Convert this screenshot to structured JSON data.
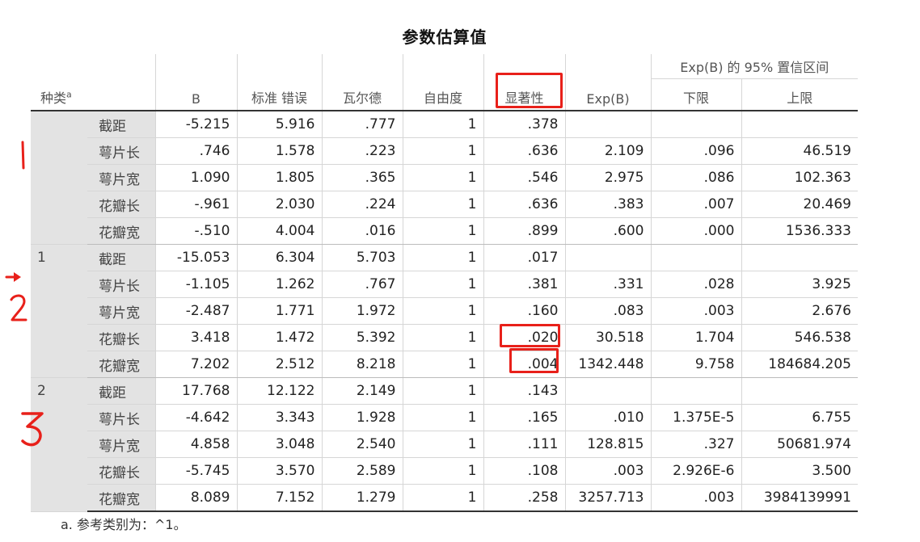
{
  "title": "参数估算值",
  "headers": {
    "group": "种类",
    "group_sup": "a",
    "b": "B",
    "se": "标准 错误",
    "wald": "瓦尔德",
    "df": "自由度",
    "sig": "显著性",
    "expb": "Exp(B)",
    "ci_title": "Exp(B) 的 95% 置信区间",
    "ci_lower": "下限",
    "ci_upper": "上限"
  },
  "groups": [
    {
      "label": "",
      "rows": [
        {
          "param": "截距",
          "b": "-5.215",
          "se": "5.916",
          "wald": ".777",
          "df": "1",
          "sig": ".378",
          "expb": "",
          "lower": "",
          "upper": ""
        },
        {
          "param": "萼片长",
          "b": ".746",
          "se": "1.578",
          "wald": ".223",
          "df": "1",
          "sig": ".636",
          "expb": "2.109",
          "lower": ".096",
          "upper": "46.519"
        },
        {
          "param": "萼片宽",
          "b": "1.090",
          "se": "1.805",
          "wald": ".365",
          "df": "1",
          "sig": ".546",
          "expb": "2.975",
          "lower": ".086",
          "upper": "102.363"
        },
        {
          "param": "花瓣长",
          "b": "-.961",
          "se": "2.030",
          "wald": ".224",
          "df": "1",
          "sig": ".636",
          "expb": ".383",
          "lower": ".007",
          "upper": "20.469"
        },
        {
          "param": "花瓣宽",
          "b": "-.510",
          "se": "4.004",
          "wald": ".016",
          "df": "1",
          "sig": ".899",
          "expb": ".600",
          "lower": ".000",
          "upper": "1536.333"
        }
      ]
    },
    {
      "label": "1",
      "rows": [
        {
          "param": "截距",
          "b": "-15.053",
          "se": "6.304",
          "wald": "5.703",
          "df": "1",
          "sig": ".017",
          "expb": "",
          "lower": "",
          "upper": ""
        },
        {
          "param": "萼片长",
          "b": "-1.105",
          "se": "1.262",
          "wald": ".767",
          "df": "1",
          "sig": ".381",
          "expb": ".331",
          "lower": ".028",
          "upper": "3.925"
        },
        {
          "param": "萼片宽",
          "b": "-2.487",
          "se": "1.771",
          "wald": "1.972",
          "df": "1",
          "sig": ".160",
          "expb": ".083",
          "lower": ".003",
          "upper": "2.676"
        },
        {
          "param": "花瓣长",
          "b": "3.418",
          "se": "1.472",
          "wald": "5.392",
          "df": "1",
          "sig": ".020",
          "expb": "30.518",
          "lower": "1.704",
          "upper": "546.538"
        },
        {
          "param": "花瓣宽",
          "b": "7.202",
          "se": "2.512",
          "wald": "8.218",
          "df": "1",
          "sig": ".004",
          "expb": "1342.448",
          "lower": "9.758",
          "upper": "184684.205"
        }
      ]
    },
    {
      "label": "2",
      "rows": [
        {
          "param": "截距",
          "b": "17.768",
          "se": "12.122",
          "wald": "2.149",
          "df": "1",
          "sig": ".143",
          "expb": "",
          "lower": "",
          "upper": ""
        },
        {
          "param": "萼片长",
          "b": "-4.642",
          "se": "3.343",
          "wald": "1.928",
          "df": "1",
          "sig": ".165",
          "expb": ".010",
          "lower": "1.375E-5",
          "upper": "6.755"
        },
        {
          "param": "萼片宽",
          "b": "4.858",
          "se": "3.048",
          "wald": "2.540",
          "df": "1",
          "sig": ".111",
          "expb": "128.815",
          "lower": ".327",
          "upper": "50681.974"
        },
        {
          "param": "花瓣长",
          "b": "-5.745",
          "se": "3.570",
          "wald": "2.589",
          "df": "1",
          "sig": ".108",
          "expb": ".003",
          "lower": "2.926E-6",
          "upper": "3.500"
        },
        {
          "param": "花瓣宽",
          "b": "8.089",
          "se": "7.152",
          "wald": "1.279",
          "df": "1",
          "sig": ".258",
          "expb": "3257.713",
          "lower": ".003",
          "upper": "3984139991"
        }
      ]
    }
  ],
  "footnote": "a. 参考类别为：^1。",
  "annotations": {
    "highlight_color": "#e8201a",
    "highlighted_header": "显著性",
    "highlighted_values": [
      ".020",
      ".004"
    ],
    "margin_marks": [
      "1",
      "arrow",
      "2",
      "3"
    ]
  }
}
